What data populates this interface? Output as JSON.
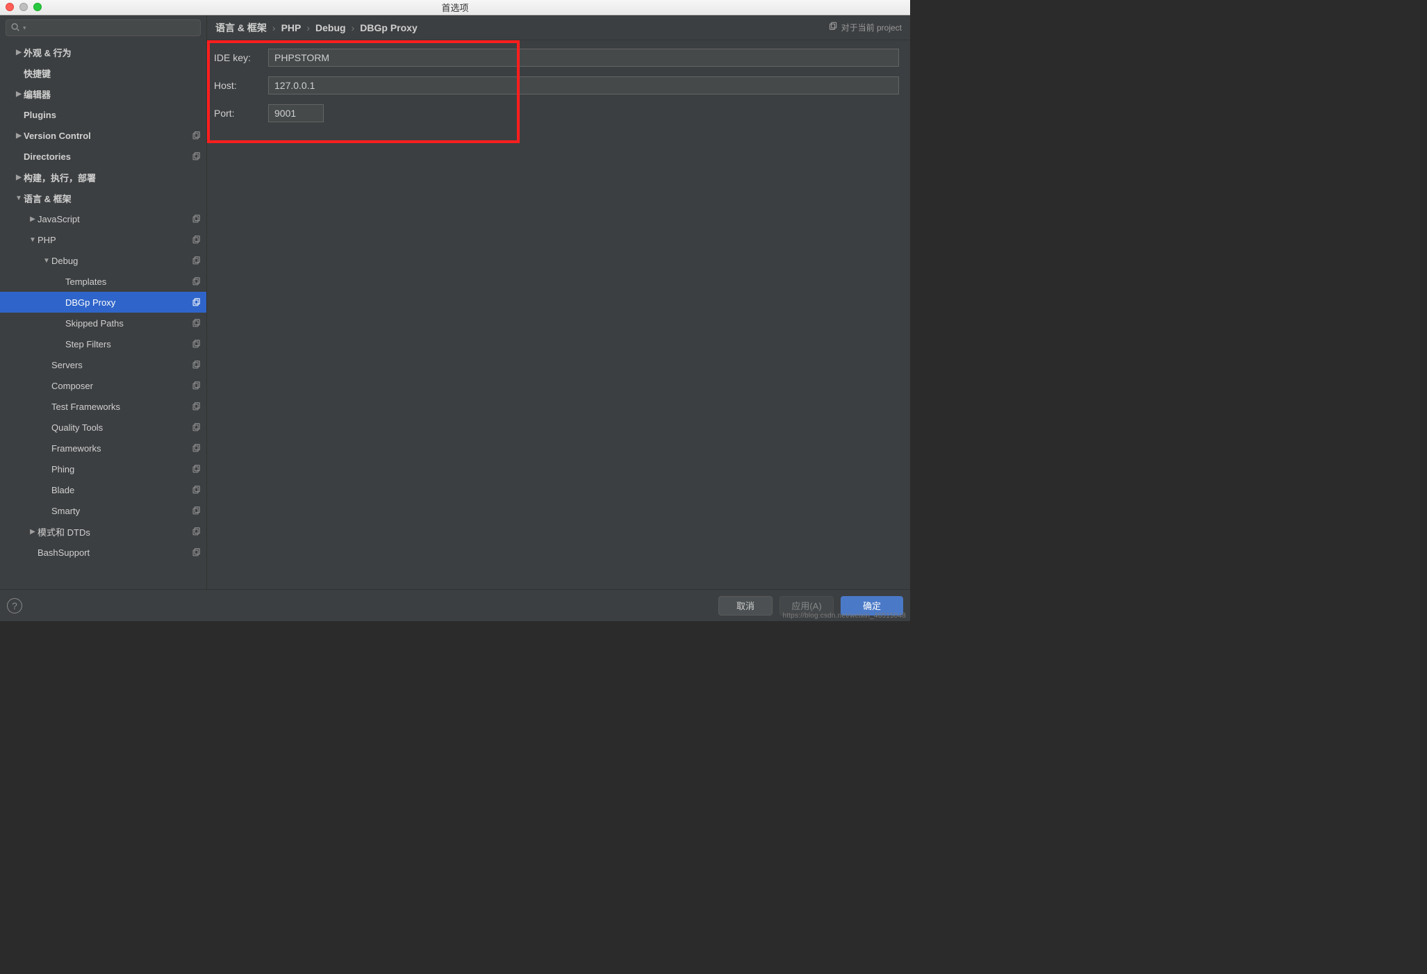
{
  "colors": {
    "accent": "#2f65ca",
    "highlight": "#ff1e1e"
  },
  "titlebar": {
    "title": "首选项"
  },
  "search": {
    "placeholder": ""
  },
  "sidebar": {
    "items": [
      {
        "label": "外观 & 行为",
        "bold": true,
        "arrow": "right",
        "indent": 1,
        "copy": false
      },
      {
        "label": "快捷键",
        "bold": true,
        "arrow": "",
        "indent": 1,
        "copy": false
      },
      {
        "label": "编辑器",
        "bold": true,
        "arrow": "right",
        "indent": 1,
        "copy": false
      },
      {
        "label": "Plugins",
        "bold": true,
        "arrow": "",
        "indent": 1,
        "copy": false
      },
      {
        "label": "Version Control",
        "bold": true,
        "arrow": "right",
        "indent": 1,
        "copy": true
      },
      {
        "label": "Directories",
        "bold": true,
        "arrow": "",
        "indent": 1,
        "copy": true
      },
      {
        "label": "构建，执行，部署",
        "bold": true,
        "arrow": "right",
        "indent": 1,
        "copy": false
      },
      {
        "label": "语言 & 框架",
        "bold": true,
        "arrow": "down",
        "indent": 1,
        "copy": false
      },
      {
        "label": "JavaScript",
        "bold": false,
        "arrow": "right",
        "indent": 2,
        "copy": true
      },
      {
        "label": "PHP",
        "bold": false,
        "arrow": "down",
        "indent": 2,
        "copy": true
      },
      {
        "label": "Debug",
        "bold": false,
        "arrow": "down",
        "indent": 3,
        "copy": true
      },
      {
        "label": "Templates",
        "bold": false,
        "arrow": "",
        "indent": 4,
        "copy": true
      },
      {
        "label": "DBGp Proxy",
        "bold": false,
        "arrow": "",
        "indent": 4,
        "copy": true,
        "selected": true
      },
      {
        "label": "Skipped Paths",
        "bold": false,
        "arrow": "",
        "indent": 4,
        "copy": true
      },
      {
        "label": "Step Filters",
        "bold": false,
        "arrow": "",
        "indent": 4,
        "copy": true
      },
      {
        "label": "Servers",
        "bold": false,
        "arrow": "",
        "indent": 3,
        "copy": true
      },
      {
        "label": "Composer",
        "bold": false,
        "arrow": "",
        "indent": 3,
        "copy": true
      },
      {
        "label": "Test Frameworks",
        "bold": false,
        "arrow": "",
        "indent": 3,
        "copy": true
      },
      {
        "label": "Quality Tools",
        "bold": false,
        "arrow": "",
        "indent": 3,
        "copy": true
      },
      {
        "label": "Frameworks",
        "bold": false,
        "arrow": "",
        "indent": 3,
        "copy": true
      },
      {
        "label": "Phing",
        "bold": false,
        "arrow": "",
        "indent": 3,
        "copy": true
      },
      {
        "label": "Blade",
        "bold": false,
        "arrow": "",
        "indent": 3,
        "copy": true
      },
      {
        "label": "Smarty",
        "bold": false,
        "arrow": "",
        "indent": 3,
        "copy": true
      },
      {
        "label": "模式和 DTDs",
        "bold": false,
        "arrow": "right",
        "indent": 2,
        "copy": true
      },
      {
        "label": "BashSupport",
        "bold": false,
        "arrow": "",
        "indent": 2,
        "copy": true
      }
    ]
  },
  "breadcrumbs": {
    "segments": [
      "语言 & 框架",
      "PHP",
      "Debug",
      "DBGp Proxy"
    ],
    "separator": "›",
    "scope_label": "对于当前 project"
  },
  "form": {
    "ide_key": {
      "label": "IDE key:",
      "value": "PHPSTORM"
    },
    "host": {
      "label": "Host:",
      "value": "127.0.0.1"
    },
    "port": {
      "label": "Port:",
      "value": "9001"
    }
  },
  "footer": {
    "help": "?",
    "cancel": "取消",
    "apply": "应用(A)",
    "ok": "确定"
  },
  "watermark": "https://blog.csdn.net/weixin_46515048"
}
